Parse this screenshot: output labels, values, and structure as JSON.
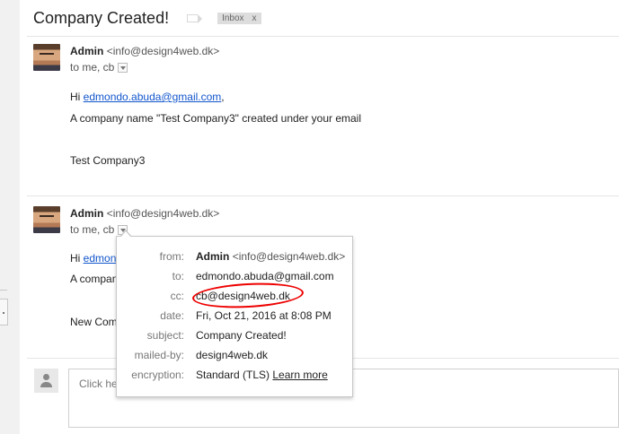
{
  "thread": {
    "subject": "Company Created!",
    "label": "Inbox",
    "label_remove": "x"
  },
  "messages": [
    {
      "sender_name": "Admin",
      "sender_email": "<info@design4web.dk>",
      "recipients": "to me, cb",
      "greeting_prefix": "Hi ",
      "greeting_link": "edmondo.abuda@gmail.com",
      "greeting_suffix": ",",
      "line1": "A company name \"Test Company3\" created under your email",
      "line2": "Test Company3"
    },
    {
      "sender_name": "Admin",
      "sender_email": "<info@design4web.dk>",
      "recipients": "to me, cb",
      "greeting_prefix": "Hi ",
      "greeting_link": "edmondo",
      "line1": "A compan",
      "line2": "New Comp"
    }
  ],
  "details_popup": {
    "from_label": "from:",
    "from_name": "Admin",
    "from_email": "<info@design4web.dk>",
    "to_label": "to:",
    "to_value": "edmondo.abuda@gmail.com",
    "cc_label": "cc:",
    "cc_value": "cb@design4web.dk",
    "date_label": "date:",
    "date_value": "Fri, Oct 21, 2016 at 8:08 PM",
    "subject_label": "subject:",
    "subject_value": "Company Created!",
    "mailedby_label": "mailed-by:",
    "mailedby_value": "design4web.dk",
    "encryption_label": "encryption:",
    "encryption_value": "Standard (TLS) ",
    "learn_more": "Learn more"
  },
  "reply": {
    "placeholder": "Click he"
  },
  "colors": {
    "link": "#1155cc",
    "annotation": "#ee0000",
    "label_bg": "#dddddd"
  }
}
